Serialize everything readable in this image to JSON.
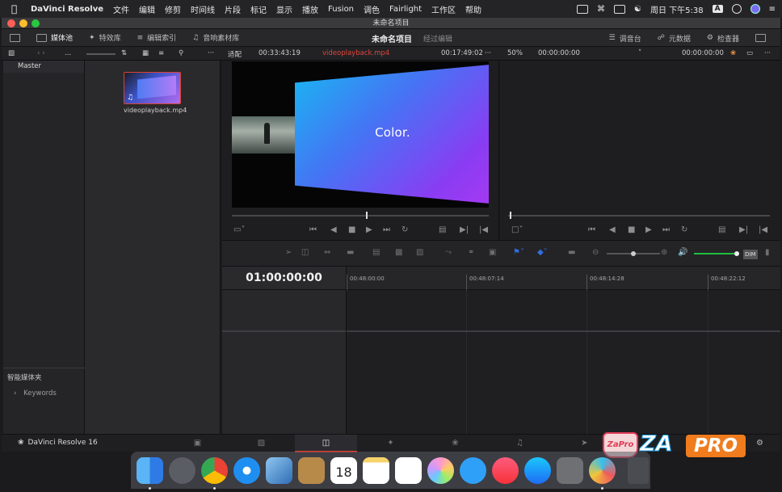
{
  "menubar": {
    "app_name": "DaVinci Resolve",
    "items": [
      "文件",
      "编辑",
      "修剪",
      "时间线",
      "片段",
      "标记",
      "显示",
      "播放",
      "Fusion",
      "调色",
      "Fairlight",
      "工作区",
      "帮助"
    ],
    "clock": "周日 下午5:38",
    "ime": "A"
  },
  "window": {
    "title": "未命名项目"
  },
  "toolbar": {
    "media_pool": "媒体池",
    "effects": "特效库",
    "edit_index": "编辑索引",
    "sound_library": "音响素材库",
    "project_name": "未命名项目",
    "sub_label": "经过编辑",
    "mixer": "调音台",
    "metadata": "元数据",
    "inspector": "检查器"
  },
  "subheader": {
    "fit": "适配",
    "src_timecode": "00:33:43:19",
    "clip_name": "videoplayback.mp4",
    "clip_duration": "00:17:49:02",
    "zoom": "50%",
    "tl_timecode_a": "00:00:00:00",
    "tl_timecode_b": "00:00:00:00"
  },
  "bins": {
    "master": "Master",
    "smart_bins": "智能媒体夹",
    "keywords": "Keywords"
  },
  "media_pool": {
    "clips": [
      {
        "name": "videoplayback.mp4"
      }
    ]
  },
  "source_viewer": {
    "slide_text": "Color."
  },
  "timeline": {
    "current_timecode": "01:00:00:00",
    "ruler_ticks": [
      "00:48:00:00",
      "00:48:07:14",
      "00:48:14:28",
      "00:48:22:12"
    ]
  },
  "pagenav": {
    "brand": "DaVinci Resolve 16",
    "pages": [
      "media",
      "cut",
      "edit",
      "fusion",
      "color",
      "fairlight",
      "deliver"
    ],
    "active_page": "edit"
  },
  "watermark": {
    "badge": "ZaPro",
    "text_a": "ZA",
    "text_b": "PRO"
  },
  "dock": {
    "apps": [
      "finder",
      "launchpad",
      "chrome",
      "safari",
      "preview",
      "notes-app",
      "calendar",
      "notes",
      "reminders",
      "photos",
      "messages",
      "music",
      "app-store",
      "system-preferences",
      "davinci-resolve",
      "trash"
    ],
    "calendar_day": "18"
  },
  "colors": {
    "accent_red": "#d93a2b",
    "volume_green": "#1fbf3f",
    "highlight_blue": "#2f6fe0"
  }
}
